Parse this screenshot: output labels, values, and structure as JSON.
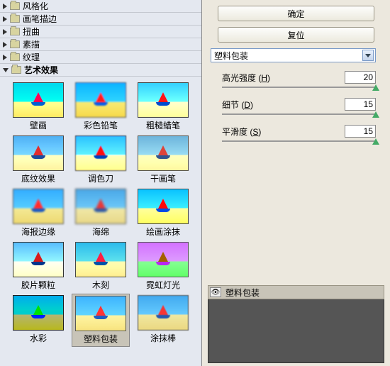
{
  "categories": [
    {
      "label": "风格化",
      "expanded": false
    },
    {
      "label": "画笔描边",
      "expanded": false
    },
    {
      "label": "扭曲",
      "expanded": false
    },
    {
      "label": "素描",
      "expanded": false
    },
    {
      "label": "纹理",
      "expanded": false
    },
    {
      "label": "艺术效果",
      "expanded": true
    }
  ],
  "filters": [
    {
      "label": "壁画"
    },
    {
      "label": "彩色铅笔"
    },
    {
      "label": "粗糙蜡笔"
    },
    {
      "label": "底纹效果"
    },
    {
      "label": "调色刀"
    },
    {
      "label": "干画笔"
    },
    {
      "label": "海报边缘"
    },
    {
      "label": "海绵"
    },
    {
      "label": "绘画涂抹"
    },
    {
      "label": "胶片颗粒"
    },
    {
      "label": "木刻"
    },
    {
      "label": "霓虹灯光"
    },
    {
      "label": "水彩"
    },
    {
      "label": "塑料包装"
    },
    {
      "label": "涂抹棒"
    }
  ],
  "selected_filter_index": 13,
  "buttons": {
    "ok": "确定",
    "reset": "复位"
  },
  "dropdown": {
    "selected": "塑料包装"
  },
  "sliders": [
    {
      "label": "高光强度",
      "hotkey": "H",
      "value": "20",
      "max": 20,
      "pos": 100
    },
    {
      "label": "细节",
      "hotkey": "D",
      "value": "15",
      "max": 15,
      "pos": 100
    },
    {
      "label": "平滑度",
      "hotkey": "S",
      "value": "15",
      "max": 15,
      "pos": 100
    }
  ],
  "preview": {
    "label": "塑料包装"
  }
}
